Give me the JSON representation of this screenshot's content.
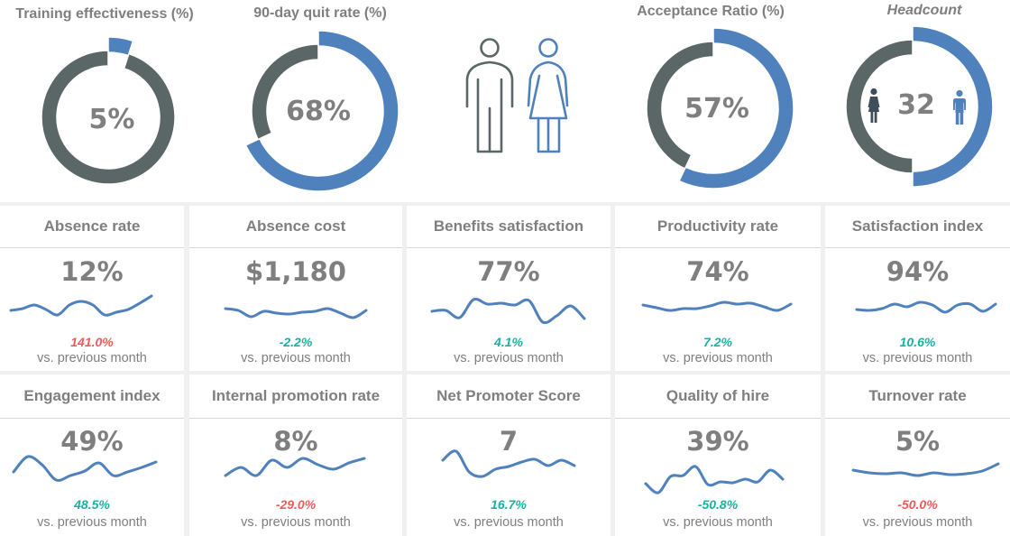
{
  "colors": {
    "accent": "#4f81bd",
    "ring_gray": "#5b6667",
    "text_gray": "#7f7f7f",
    "good": "#17b2a0",
    "bad": "#f15a5a",
    "female_icon": "#3f4c5a",
    "sparkline": "#4f81bd"
  },
  "icons": {
    "gender_pair": [
      "man-outline-icon",
      "woman-outline-icon"
    ],
    "headcount": [
      "female-icon",
      "male-icon"
    ]
  },
  "kpis": [
    {
      "title": "Absence rate",
      "value": "12%",
      "change": "141.0%",
      "status": "bad",
      "comparison": "vs. previous month"
    },
    {
      "title": "Absence cost",
      "value": "$1,180",
      "change": "-2.2%",
      "status": "good",
      "comparison": "vs. previous month"
    },
    {
      "title": "Benefits satisfaction",
      "value": "77%",
      "change": "4.1%",
      "status": "good",
      "comparison": "vs. previous month"
    },
    {
      "title": "Productivity rate",
      "value": "74%",
      "change": "7.2%",
      "status": "good",
      "comparison": "vs. previous month"
    },
    {
      "title": "Satisfaction index",
      "value": "94%",
      "change": "10.6%",
      "status": "good",
      "comparison": "vs. previous month"
    },
    {
      "title": "Engagement index",
      "value": "49%",
      "change": "48.5%",
      "status": "good",
      "comparison": "vs. previous month"
    },
    {
      "title": "Internal promotion rate",
      "value": "8%",
      "change": "-29.0%",
      "status": "bad",
      "comparison": "vs. previous month"
    },
    {
      "title": "Net Promoter Score",
      "value": "7",
      "change": "16.7%",
      "status": "good",
      "comparison": "vs. previous month"
    },
    {
      "title": "Quality of hire",
      "value": "39%",
      "change": "-50.8%",
      "status": "good",
      "comparison": "vs. previous month"
    },
    {
      "title": "Turnover rate",
      "value": "5%",
      "change": "-50.0%",
      "status": "bad",
      "comparison": "vs. previous month"
    }
  ],
  "chart_data": [
    {
      "type": "pie",
      "variant": "donut",
      "title": "Training effectiveness (%)",
      "center_label": "5%",
      "slices": [
        {
          "label": "Training effectiveness",
          "value": 5,
          "color": "#4f81bd",
          "highlight": true
        },
        {
          "label": "Remainder",
          "value": 95,
          "color": "#5b6667",
          "highlight": false
        }
      ]
    },
    {
      "type": "pie",
      "variant": "donut",
      "title": "90-day quit rate (%)",
      "center_label": "68%",
      "slices": [
        {
          "label": "90-day quit rate",
          "value": 68,
          "color": "#4f81bd",
          "highlight": true
        },
        {
          "label": "Remainder",
          "value": 32,
          "color": "#5b6667",
          "highlight": false
        }
      ]
    },
    {
      "type": "pie",
      "variant": "donut",
      "title": "Acceptance Ratio (%)",
      "center_label": "57%",
      "slices": [
        {
          "label": "Acceptance ratio",
          "value": 57,
          "color": "#4f81bd",
          "highlight": true
        },
        {
          "label": "Remainder",
          "value": 43,
          "color": "#5b6667",
          "highlight": false
        }
      ]
    },
    {
      "type": "pie",
      "variant": "donut",
      "title": "Headcount",
      "center_label": "32",
      "slices": [
        {
          "label": "Male",
          "value": 50,
          "color": "#4f81bd",
          "highlight": true
        },
        {
          "label": "Female",
          "value": 50,
          "color": "#5b6667",
          "highlight": false
        }
      ]
    },
    {
      "type": "line",
      "variant": "sparkline",
      "title": "Absence rate",
      "units": "relative",
      "values": [
        6,
        8,
        12,
        7,
        1,
        12,
        16,
        12,
        1,
        4,
        7,
        14,
        22
      ]
    },
    {
      "type": "line",
      "variant": "sparkline",
      "title": "Absence cost",
      "units": "relative",
      "values": [
        10,
        8,
        1,
        7,
        5,
        4,
        6,
        7,
        10,
        5,
        0,
        8
      ]
    },
    {
      "type": "line",
      "variant": "sparkline",
      "title": "Benefits satisfaction",
      "units": "relative",
      "values": [
        13,
        14,
        6,
        26,
        21,
        22,
        20,
        25,
        1,
        8,
        19,
        5
      ]
    },
    {
      "type": "line",
      "variant": "sparkline",
      "title": "Productivity rate",
      "units": "relative",
      "values": [
        7,
        4,
        1,
        3,
        3,
        6,
        10,
        8,
        9,
        5,
        1,
        8
      ]
    },
    {
      "type": "line",
      "variant": "sparkline",
      "title": "Satisfaction index",
      "units": "relative",
      "values": [
        4,
        3,
        5,
        10,
        7,
        12,
        9,
        1,
        9,
        10,
        2,
        10
      ]
    },
    {
      "type": "line",
      "variant": "sparkline",
      "title": "Engagement index",
      "units": "relative",
      "values": [
        10,
        27,
        18,
        1,
        6,
        11,
        20,
        6,
        10,
        15,
        21
      ]
    },
    {
      "type": "line",
      "variant": "sparkline",
      "title": "Internal promotion rate",
      "units": "relative",
      "values": [
        1,
        10,
        1,
        18,
        10,
        20,
        13,
        8,
        15,
        20
      ]
    },
    {
      "type": "line",
      "variant": "sparkline",
      "title": "Net Promoter Score",
      "units": "relative",
      "values": [
        20,
        30,
        7,
        2,
        10,
        13,
        18,
        21,
        14,
        20,
        14
      ]
    },
    {
      "type": "line",
      "variant": "sparkline",
      "title": "Quality of hire",
      "units": "relative",
      "values": [
        12,
        2,
        20,
        21,
        31,
        11,
        14,
        13,
        17,
        14,
        27,
        17
      ]
    },
    {
      "type": "line",
      "variant": "sparkline",
      "title": "Turnover rate",
      "units": "relative",
      "values": [
        7,
        4,
        3,
        4,
        1,
        4,
        2,
        3,
        6,
        14
      ]
    }
  ]
}
